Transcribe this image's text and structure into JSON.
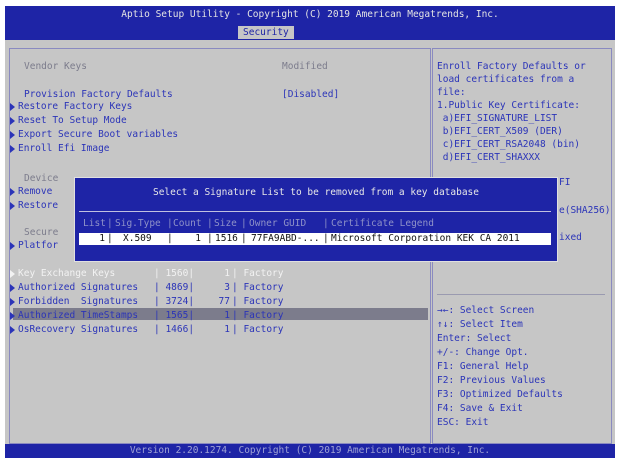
{
  "title": "Aptio Setup Utility - Copyright (C) 2019 American Megatrends, Inc.",
  "active_tab": "Security",
  "main": {
    "vendor_keys_label": "Vendor Keys",
    "vendor_keys_value": "Modified",
    "provision_label": "Provision Factory Defaults",
    "provision_value": "[Disabled]",
    "menu_items": [
      "Restore Factory Keys",
      "Reset To Setup Mode",
      "Export Secure Boot variables",
      "Enroll Efi Image"
    ],
    "device_label": "Device",
    "remove_label": "Remove",
    "restore_label": "Restore",
    "secure_label": "Secure",
    "platform_label": "Platfor",
    "key_rows": [
      {
        "name": "Key Exchange Keys",
        "size": "1560",
        "count": "1",
        "source": "Factory"
      },
      {
        "name": "Authorized Signatures",
        "size": "4869",
        "count": "3",
        "source": "Factory"
      },
      {
        "name": "Forbidden  Signatures",
        "size": "3724",
        "count": "77",
        "source": "Factory"
      },
      {
        "name": "Authorized TimeStamps",
        "size": "1565",
        "count": "1",
        "source": "Factory"
      },
      {
        "name": "OsRecovery Signatures",
        "size": "1466",
        "count": "1",
        "source": "Factory"
      }
    ]
  },
  "help": {
    "description": [
      "Enroll Factory Defaults or",
      "load certificates from a",
      "file:",
      "1.Public Key Certificate:",
      " a)EFI_SIGNATURE_LIST",
      " b)EFI_CERT_X509 (DER)",
      " c)EFI_CERT_RSA2048 (bin)",
      " d)EFI_CERT_SHAXXX"
    ],
    "partial_1": "FI",
    "partial_2": "e(SHA256)",
    "partial_3": "ixed",
    "keys": [
      "→←: Select Screen",
      "↑↓: Select Item",
      "Enter: Select",
      "+/-: Change Opt.",
      "F1: General Help",
      "F2: Previous Values",
      "F3: Optimized Defaults",
      "F4: Save & Exit",
      "ESC: Exit"
    ]
  },
  "dialog": {
    "title": "Select a Signature List to be removed from a key database",
    "headers": {
      "list": "List",
      "sig_type": "Sig.Type",
      "count": "Count",
      "size": "Size",
      "owner_guid": "Owner GUID",
      "legend": "Certificate Legend"
    },
    "row": {
      "list": "1",
      "sig_type": "X.509",
      "count": "1",
      "size": "1516",
      "owner_guid": "77FA9ABD-...",
      "legend": "Microsoft Corporation KEK CA 2011"
    }
  },
  "footer": "Version 2.20.1274. Copyright (C) 2019 American Megatrends, Inc."
}
